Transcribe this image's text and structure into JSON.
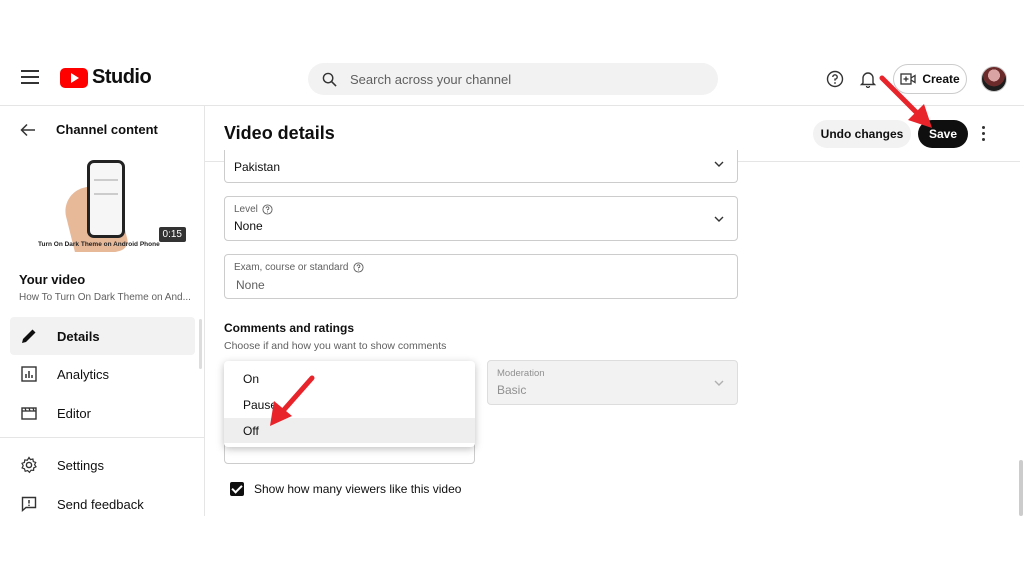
{
  "app": {
    "name": "Studio"
  },
  "search": {
    "placeholder": "Search across your channel"
  },
  "topbar": {
    "create_label": "Create"
  },
  "sidebar": {
    "back_label": "Channel content",
    "thumbnail_caption": "Turn On Dark Theme on Android Phone",
    "duration": "0:15",
    "your_video_label": "Your video",
    "video_title": "How To Turn On Dark Theme on And...",
    "items": [
      {
        "label": "Details",
        "icon": "pencil-icon",
        "active": true
      },
      {
        "label": "Analytics",
        "icon": "analytics-icon",
        "active": false
      },
      {
        "label": "Editor",
        "icon": "editor-icon",
        "active": false
      },
      {
        "label": "Settings",
        "icon": "gear-icon",
        "active": false
      },
      {
        "label": "Send feedback",
        "icon": "feedback-icon",
        "active": false
      }
    ]
  },
  "header": {
    "title": "Video details",
    "undo_label": "Undo changes",
    "save_label": "Save"
  },
  "form": {
    "country_value": "Pakistan",
    "level_label": "Level",
    "level_value": "None",
    "exam_label": "Exam, course or standard",
    "exam_value": "None",
    "comments_title": "Comments and ratings",
    "comments_subtitle": "Choose if and how you want to show comments",
    "moderation_label": "Moderation",
    "moderation_value": "Basic",
    "comment_options": [
      "On",
      "Pause",
      "Off"
    ],
    "comment_selected": "Off",
    "likes_checkbox_label": "Show how many viewers like this video",
    "likes_checkbox_checked": true
  },
  "colors": {
    "brand": "#ff0000",
    "save_bg": "#0f0f0f",
    "annotation_arrow": "#e8232a"
  }
}
